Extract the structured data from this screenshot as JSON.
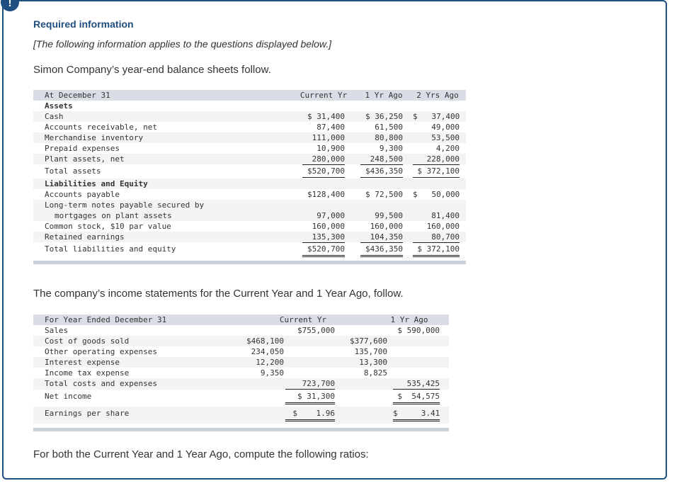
{
  "alert": {
    "icon": "!",
    "title": "Required information",
    "note": "[The following information applies to the questions displayed below.]"
  },
  "intro": "Simon Company’s year-end balance sheets follow.",
  "balance_sheet": {
    "header": {
      "label": "At December 31",
      "cols": [
        "Current Yr",
        "1 Yr Ago",
        "2 Yrs Ago"
      ]
    },
    "assets_heading": "Assets",
    "assets": [
      {
        "label": "Cash",
        "values": [
          "$ 31,400",
          "$ 36,250",
          "$   37,400"
        ]
      },
      {
        "label": "Accounts receivable, net",
        "values": [
          "87,400",
          "61,500",
          "49,000"
        ]
      },
      {
        "label": "Merchandise inventory",
        "values": [
          "111,000",
          "80,800",
          "53,500"
        ]
      },
      {
        "label": "Prepaid expenses",
        "values": [
          "10,900",
          "9,300",
          "4,200"
        ]
      },
      {
        "label": "Plant assets, net",
        "values": [
          "280,000",
          "248,500",
          "228,000"
        ]
      }
    ],
    "total_assets": {
      "label": "Total assets",
      "values": [
        "$520,700",
        "$436,350",
        "$ 372,100"
      ]
    },
    "liab_heading": "Liabilities and Equity",
    "liabilities": [
      {
        "label": "Accounts payable",
        "values": [
          "$128,400",
          "$ 72,500",
          "$   50,000"
        ]
      },
      {
        "label": "Long-term notes payable secured by",
        "label2": "mortgages on plant assets",
        "values": [
          "97,000",
          "99,500",
          "81,400"
        ]
      },
      {
        "label": "Common stock, $10 par value",
        "values": [
          "160,000",
          "160,000",
          "160,000"
        ]
      },
      {
        "label": "Retained earnings",
        "values": [
          "135,300",
          "104,350",
          "80,700"
        ]
      }
    ],
    "total_liab": {
      "label": "Total liabilities and equity",
      "values": [
        "$520,700",
        "$436,350",
        "$ 372,100"
      ]
    }
  },
  "mid_text": "The company’s income statements for the Current Year and 1 Year Ago, follow.",
  "income_statement": {
    "header": {
      "label": "For Year Ended December 31",
      "cols": [
        "Current Yr",
        "1 Yr Ago"
      ]
    },
    "sales": {
      "label": "Sales",
      "cy": "$755,000",
      "py": "$ 590,000"
    },
    "expenses": [
      {
        "label": "Cost of goods sold",
        "cy": "$468,100",
        "py": "$377,600"
      },
      {
        "label": "Other operating expenses",
        "cy": "234,050",
        "py": "135,700"
      },
      {
        "label": "Interest expense",
        "cy": "12,200",
        "py": "13,300"
      },
      {
        "label": "Income tax expense",
        "cy": "9,350",
        "py": "8,825"
      }
    ],
    "total": {
      "label": "Total costs and expenses",
      "cy": "723,700",
      "py": "535,425"
    },
    "net_income": {
      "label": "Net income",
      "cy": "$ 31,300",
      "py": "$  54,575"
    },
    "eps": {
      "label": "Earnings per share",
      "cy": "$    1.96",
      "py": "$     3.41"
    }
  },
  "outro": "For both the Current Year and 1 Year Ago, compute the following ratios:"
}
